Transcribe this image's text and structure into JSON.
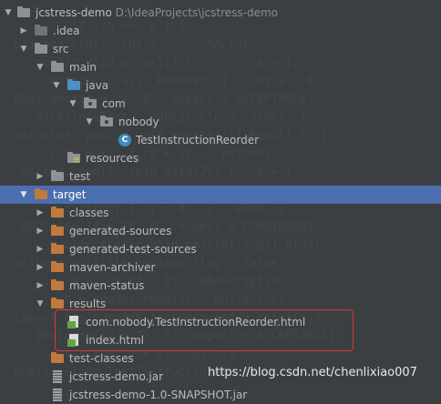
{
  "project": {
    "name": "jcstress-demo",
    "path": "D:\\IdeaProjects\\jcstress-demo"
  },
  "tree": {
    "idea": ".idea",
    "src": "src",
    "main": "main",
    "java": "java",
    "com": "com",
    "nobody": "nobody",
    "test_class": "TestInstructionReorder",
    "resources": "resources",
    "test": "test",
    "target": "target",
    "classes": "classes",
    "generated_sources": "generated-sources",
    "generated_test_sources": "generated-test-sources",
    "maven_archiver": "maven-archiver",
    "maven_status": "maven-status",
    "results": "results",
    "result_html": "com.nobody.TestInstructionReorder.html",
    "index_html": "index.html",
    "test_classes": "test-classes",
    "jar": "jcstress-demo.jar",
    "last_partial": "jcstress-demo-1.0-SNAPSHOT.jar"
  },
  "watermark": "https://blog.csdn.net/chenlixiao007",
  "colors": {
    "background": "#3c3f41",
    "selection": "#4b6eaf",
    "highlight_border": "#d33a36"
  },
  "icons": {
    "arrow_expanded": "▼",
    "arrow_collapsed": "▶",
    "class_letter": "C"
  }
}
